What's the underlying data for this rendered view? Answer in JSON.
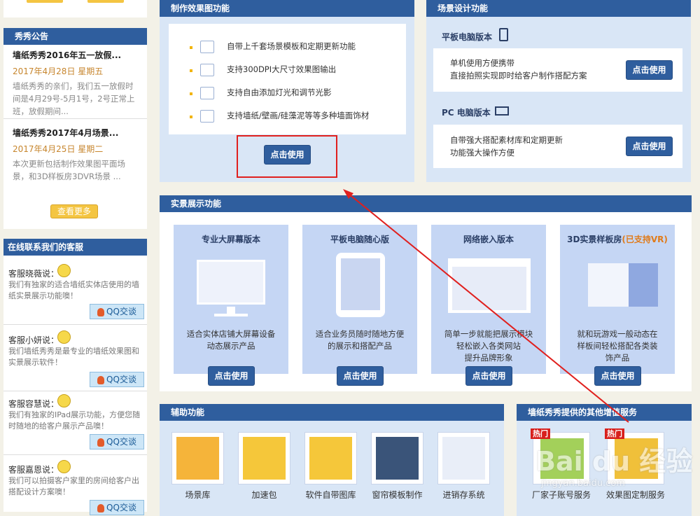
{
  "sidebar": {
    "announce_title": "秀秀公告",
    "announcements": [
      {
        "title": "墙纸秀秀2016年五一放假...",
        "date": "2017年4月28日  星期五",
        "body": "墙纸秀秀的亲们，我们五一放假时间是4月29号-5月1号，2号正常上班，放假期间..."
      },
      {
        "title": "墙纸秀秀2017年4月场景...",
        "date": "2017年4月25日  星期二",
        "body": "本次更新包括制作效果图平面场景，和3D样板房3DVR场景 ..."
      }
    ],
    "more_label": "查看更多",
    "contact_title": "在线联系我们的客服",
    "services": [
      {
        "name": "客服晓薇说：",
        "msg": "我们有独家的适合墙纸实体店使用的墙纸实景展示功能噢！",
        "btn": "QQ交谈"
      },
      {
        "name": "客服小妍说：",
        "msg": "我们墙纸秀秀是最专业的墙纸效果图和实景展示软件！",
        "btn": "QQ交谈"
      },
      {
        "name": "客服容慧说：",
        "msg": "我们有独家的IPad展示功能，方便您随时随地的给客户展示产品噢！",
        "btn": "QQ交谈"
      },
      {
        "name": "客服嘉恩说：",
        "msg": "我们可以拍摄客户家里的房间给客户出搭配设计方案噢！",
        "btn": "QQ交谈"
      }
    ]
  },
  "render": {
    "title": "制作效果图功能",
    "features": [
      "自带上千套场景模板和定期更新功能",
      "支持300DPI大尺寸效果图输出",
      "支持自由添加灯光和调节光影",
      "支持墙纸/壁画/硅藻泥等等多种墙面饰材"
    ],
    "use_label": "点击使用"
  },
  "scene": {
    "title": "场景设计功能",
    "tablet_label": "平板电脑版本",
    "tablet_desc": [
      "单机使用方便携带",
      "直接拍照实现即时给客户制作搭配方案"
    ],
    "pc_label": "PC 电脑版本",
    "pc_desc": [
      "自带强大搭配素材库和定期更新",
      "功能强大操作方便"
    ],
    "use_label": "点击使用"
  },
  "reality": {
    "title": "实景展示功能",
    "cards": [
      {
        "title": "专业大屏幕版本",
        "desc": [
          "适合实体店铺大屏幕设备",
          "动态展示产品"
        ],
        "btn": "点击使用"
      },
      {
        "title": "平板电脑随心版",
        "desc": [
          "适合业务员随时随地方便",
          "的展示和搭配产品"
        ],
        "btn": "点击使用"
      },
      {
        "title": "网络嵌入版本",
        "desc": [
          "简单一步就能把展示模块",
          "轻松嵌入各类网站",
          "提升品牌形象"
        ],
        "btn": "点击使用"
      },
      {
        "title": "3D实景样板房",
        "title_extra": "(已支持VR)",
        "desc": [
          "就和玩游戏一般动态在",
          "样板间轻松搭配各类装",
          "饰产品"
        ],
        "btn": "点击使用"
      }
    ]
  },
  "aux": {
    "title": "辅助功能",
    "items": [
      "场景库",
      "加速包",
      "软件自带图库",
      "窗帘模板制作",
      "进销存系统"
    ]
  },
  "value_added": {
    "title": "墙纸秀秀提供的其他增值服务",
    "hot_label": "热门",
    "items": [
      "厂家子账号服务",
      "效果图定制服务"
    ]
  },
  "watermark": {
    "text": "Bai du 经验",
    "url": "jingyan.baidu.com"
  },
  "colors": {
    "header": "#2f5e9e",
    "panel": "#d9e6f6",
    "highlight": "#e0201e",
    "date": "#c7862e",
    "more_btn": "#f4c542"
  }
}
